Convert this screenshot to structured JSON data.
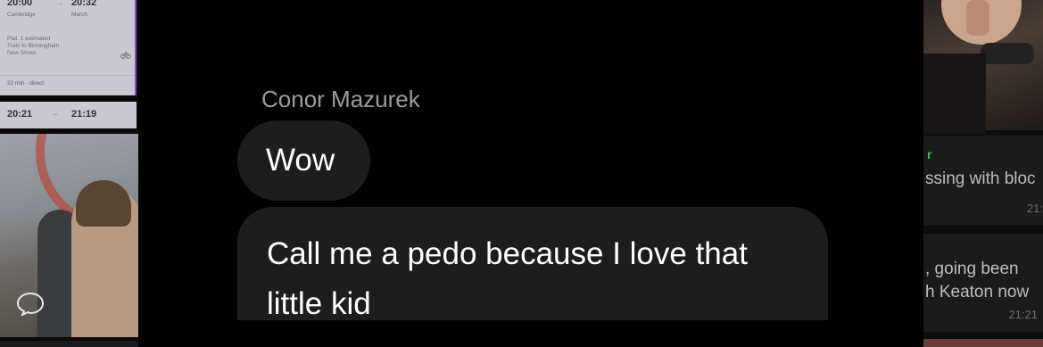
{
  "left_panel": {
    "train_card": {
      "depart_time": "20:00",
      "arrive_time": "20:32",
      "depart_station": "Cambridge",
      "arrive_station": "March",
      "detail_lines": [
        "Plat. 1 estimated",
        "Train to Birmingham",
        "New Street"
      ],
      "summary": "32 min · direct",
      "icon": "bike-icon",
      "accent_color": "#7a4fc7"
    },
    "train_card_2": {
      "depart_time": "20:21",
      "arrive_time": "21:19"
    },
    "photo_icon": "chat-bubble-icon"
  },
  "chat": {
    "sender": "Conor Mazurek",
    "messages": [
      {
        "text": "Wow"
      },
      {
        "text": "Call me a pedo because I love that little kid"
      }
    ],
    "bubble_color": "#1d1d1e"
  },
  "right_panel": {
    "card1": {
      "sender_fragment": "r",
      "text_fragment": "ssing with bloc",
      "time_fragment": "21:"
    },
    "card2": {
      "line1": ", going been",
      "line2": "h Keaton now",
      "time": "21:21"
    },
    "sender_color": "#2fc24c"
  }
}
